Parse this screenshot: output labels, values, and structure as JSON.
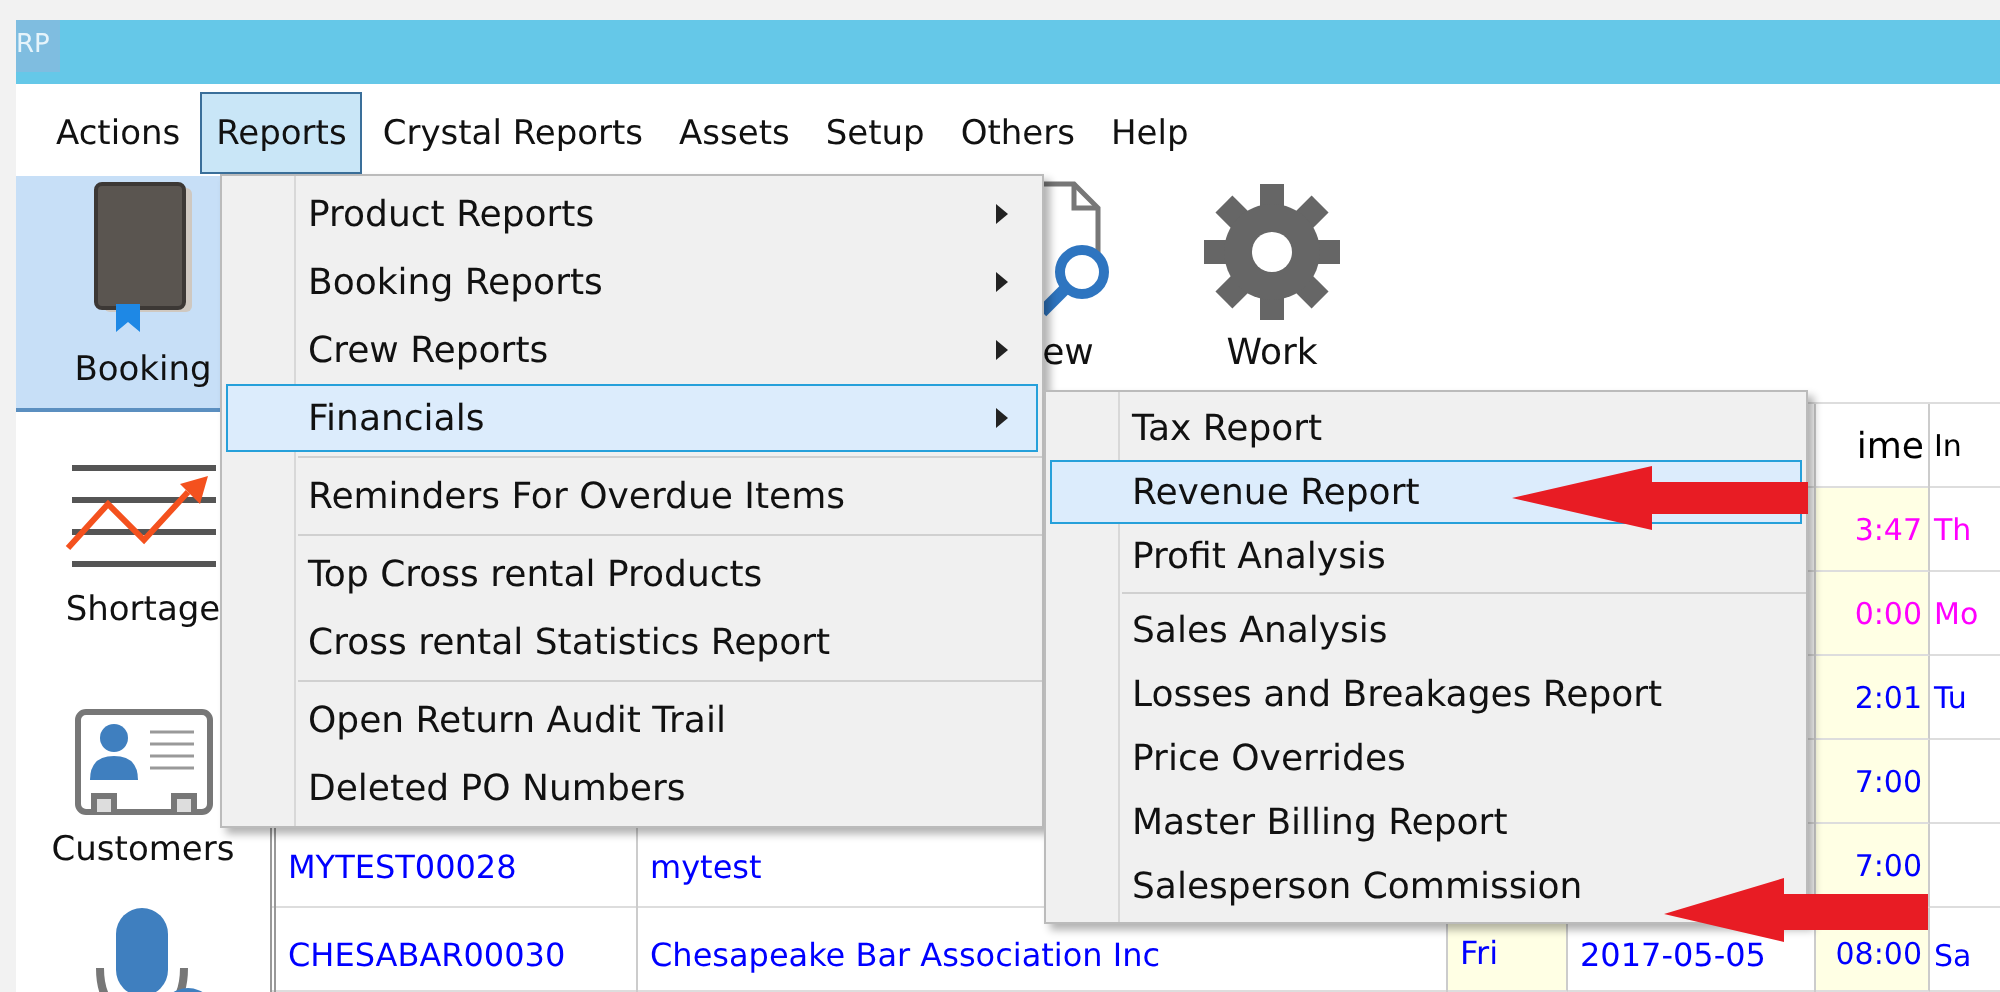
{
  "title_bar": {
    "logo_text": "RP"
  },
  "menu_bar": [
    {
      "label": "Actions",
      "selected": false
    },
    {
      "label": "Reports",
      "selected": true
    },
    {
      "label": "Crystal Reports",
      "selected": false
    },
    {
      "label": "Assets",
      "selected": false
    },
    {
      "label": "Setup",
      "selected": false
    },
    {
      "label": "Others",
      "selected": false
    },
    {
      "label": "Help",
      "selected": false
    }
  ],
  "sidebar": [
    {
      "label": "Booking",
      "kind": "book",
      "selected": true
    },
    {
      "label": "Shortage",
      "kind": "trend",
      "selected": false
    },
    {
      "label": "Customers",
      "kind": "card",
      "selected": false
    },
    {
      "kind": "microphone",
      "selected": false
    }
  ],
  "toolbar": [
    {
      "label": "ew",
      "kind": "document-search"
    },
    {
      "label": "Work",
      "kind": "gear"
    }
  ],
  "table": {
    "column_headers": {
      "time": "ime",
      "column_6": "In"
    },
    "rows": [
      {
        "time": "3:47",
        "column_6": "Th",
        "color": "#ff00ff"
      },
      {
        "time": "0:00",
        "column_6": "Mo",
        "color": "#ff00ff"
      },
      {
        "time": "2:01",
        "column_6": "Tu",
        "color": "#0000ff"
      },
      {
        "time": "7:00",
        "color": "#0000ff"
      },
      {
        "id": "MYTEST00028",
        "name": "mytest",
        "time": "7:00",
        "color": "#0000ff"
      },
      {
        "id": "CHESABAR00030",
        "name": "Chesapeake Bar Association Inc",
        "day": "Fri",
        "date": "2017-05-05",
        "time": "08:00",
        "column_6": "Sa",
        "color": "#0000ff"
      }
    ]
  },
  "reports_menu": {
    "items": [
      {
        "label": "Product Reports",
        "kind": "submenu",
        "selected": false
      },
      {
        "label": "Booking Reports",
        "kind": "submenu",
        "selected": false
      },
      {
        "label": "Crew Reports",
        "kind": "submenu",
        "selected": false
      },
      {
        "label": "Financials",
        "kind": "submenu",
        "selected": true
      },
      {
        "kind": "separator"
      },
      {
        "label": "Reminders For Overdue Items",
        "kind": "item",
        "selected": false
      },
      {
        "kind": "separator"
      },
      {
        "label": "Top Cross rental Products",
        "kind": "item",
        "selected": false
      },
      {
        "label": "Cross rental Statistics Report",
        "kind": "item",
        "selected": false
      },
      {
        "kind": "separator"
      },
      {
        "label": "Open Return Audit Trail",
        "kind": "item",
        "selected": false
      },
      {
        "label": "Deleted PO Numbers",
        "kind": "item",
        "selected": false
      }
    ]
  },
  "financials_submenu": {
    "items": [
      {
        "label": "Tax Report",
        "kind": "item",
        "selected": false
      },
      {
        "label": "Revenue Report",
        "kind": "item",
        "selected": true
      },
      {
        "label": "Profit Analysis",
        "kind": "item",
        "selected": false
      },
      {
        "kind": "separator"
      },
      {
        "label": "Sales Analysis",
        "kind": "item",
        "selected": false
      },
      {
        "label": "Losses and Breakages Report",
        "kind": "item",
        "selected": false
      },
      {
        "label": "Price Overrides",
        "kind": "item",
        "selected": false
      },
      {
        "label": "Master Billing Report",
        "kind": "item",
        "selected": false
      },
      {
        "label": "Salesperson Commission",
        "kind": "item",
        "selected": false
      }
    ]
  }
}
